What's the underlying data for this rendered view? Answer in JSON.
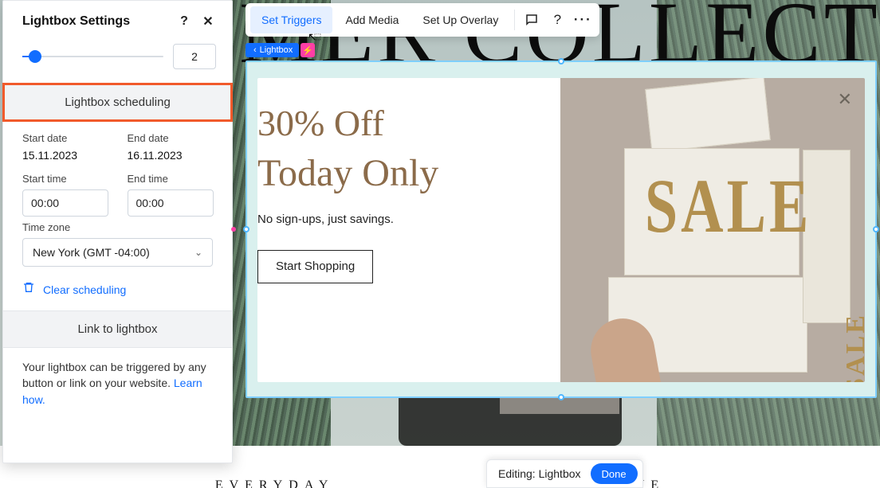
{
  "panel": {
    "title": "Lightbox Settings",
    "slider_value": "2",
    "scheduling_header": "Lightbox scheduling",
    "start_date_label": "Start date",
    "start_date": "15.11.2023",
    "end_date_label": "End date",
    "end_date": "16.11.2023",
    "start_time_label": "Start time",
    "start_time": "00:00",
    "end_time_label": "End time",
    "end_time": "00:00",
    "tz_label": "Time zone",
    "tz_value": "New York (GMT -04:00)",
    "clear_label": "Clear scheduling",
    "link_header": "Link to lightbox",
    "link_desc": "Your lightbox can be triggered by any button or link on your website. ",
    "learn_how": "Learn how."
  },
  "ctx": {
    "tab1": "Set Triggers",
    "tab2": "Add Media",
    "tab3": "Set Up Overlay"
  },
  "crumb": {
    "label": "Lightbox"
  },
  "lightbox": {
    "line1": "30% Off",
    "line2": "Today Only",
    "sub": "No sign-ups, just savings.",
    "cta": "Start Shopping",
    "sale": "SALE"
  },
  "bg": {
    "big1": "MER ",
    "big2": "COLLECT",
    "sub1": "EVERYDAY",
    "sub2": "VERYONE"
  },
  "editbar": {
    "label": "Editing: Lightbox",
    "done": "Done"
  }
}
